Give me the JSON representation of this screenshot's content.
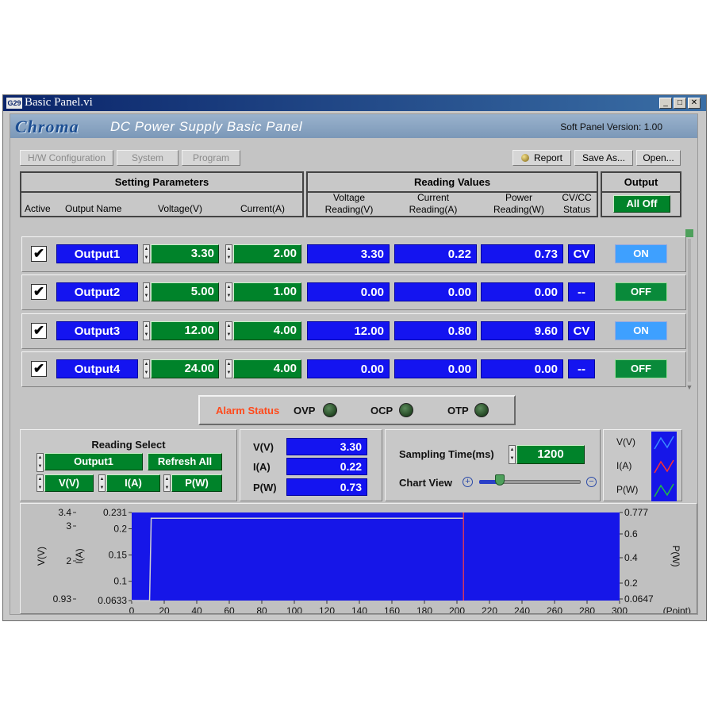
{
  "window": {
    "title": "Basic Panel.vi",
    "icon_text": "G29",
    "controls": [
      "minimize",
      "maximize",
      "close"
    ]
  },
  "header": {
    "logo": "Chroma",
    "title": "DC Power Supply Basic Panel",
    "version_label": "Soft Panel Version:",
    "version": "1.00"
  },
  "toolbar": {
    "hw_config": "H/W Configuration",
    "system": "System",
    "program": "Program",
    "report": "Report",
    "save_as": "Save As...",
    "open": "Open..."
  },
  "setting": {
    "title": "Setting Parameters",
    "col_active": "Active",
    "col_name": "Output Name",
    "col_voltage": "Voltage(V)",
    "col_current": "Current(A)"
  },
  "reading": {
    "title": "Reading Values",
    "col_voltage_1": "Voltage",
    "col_voltage_2": "Reading(V)",
    "col_current_1": "Current",
    "col_current_2": "Reading(A)",
    "col_power_1": "Power",
    "col_power_2": "Reading(W)",
    "col_status_1": "CV/CC",
    "col_status_2": "Status"
  },
  "output": {
    "title": "Output",
    "all_off": "All Off"
  },
  "rows": [
    {
      "active": "✔",
      "name": "Output1",
      "voltage": "3.30",
      "current": "2.00",
      "v_read": "3.30",
      "a_read": "0.22",
      "w_read": "0.73",
      "status": "CV",
      "state": "ON"
    },
    {
      "active": "✔",
      "name": "Output2",
      "voltage": "5.00",
      "current": "1.00",
      "v_read": "0.00",
      "a_read": "0.00",
      "w_read": "0.00",
      "status": "--",
      "state": "OFF"
    },
    {
      "active": "✔",
      "name": "Output3",
      "voltage": "12.00",
      "current": "4.00",
      "v_read": "12.00",
      "a_read": "0.80",
      "w_read": "9.60",
      "status": "CV",
      "state": "ON"
    },
    {
      "active": "✔",
      "name": "Output4",
      "voltage": "24.00",
      "current": "4.00",
      "v_read": "0.00",
      "a_read": "0.00",
      "w_read": "0.00",
      "status": "--",
      "state": "OFF"
    }
  ],
  "alarm": {
    "label": "Alarm Status",
    "ovp": "OVP",
    "ocp": "OCP",
    "otp": "OTP"
  },
  "reading_select": {
    "title": "Reading Select",
    "output": "Output1",
    "refresh": "Refresh All",
    "v": "V(V)",
    "i": "I(A)",
    "p": "P(W)"
  },
  "live": {
    "v_label": "V(V)",
    "v_value": "3.30",
    "i_label": "I(A)",
    "i_value": "0.22",
    "p_label": "P(W)",
    "p_value": "0.73"
  },
  "sampling": {
    "label": "Sampling Time(ms)",
    "value": "1200",
    "chart_view": "Chart View",
    "zoom_level": 0.2
  },
  "legend": {
    "v": "V(V)",
    "i": "I(A)",
    "p": "P(W)"
  },
  "colors": {
    "plot_bg": "#1616e8",
    "v_trace": "#3c8cff",
    "i_trace": "#ff3030",
    "p_trace": "#20c040",
    "cursor": "#ff4040"
  },
  "chart_data": {
    "type": "line",
    "x_label": "(Point)",
    "x_range": [
      0,
      300
    ],
    "x_ticks": [
      "0",
      "20",
      "40",
      "60",
      "80",
      "100",
      "120",
      "140",
      "160",
      "180",
      "200",
      "220",
      "240",
      "260",
      "280",
      "300"
    ],
    "left_axis_v": {
      "label": "V(V)",
      "ticks": [
        "3.4",
        "3",
        "2",
        "0.93"
      ]
    },
    "left_axis_i": {
      "label": "I(A)",
      "ticks": [
        "0.231",
        "0.2",
        "0.15",
        "0.1",
        "0.0633"
      ]
    },
    "right_axis_p": {
      "label": "P(W)",
      "ticks": [
        "0.777",
        "0.6",
        "0.4",
        "0.2",
        "0.0647"
      ]
    },
    "i_range": [
      0.0633,
      0.231
    ],
    "series": [
      {
        "name": "I(A)",
        "x": [
          0,
          11,
          12,
          204
        ],
        "y": [
          0.0633,
          0.0633,
          0.22,
          0.22
        ]
      }
    ],
    "cursor_x": 204
  }
}
